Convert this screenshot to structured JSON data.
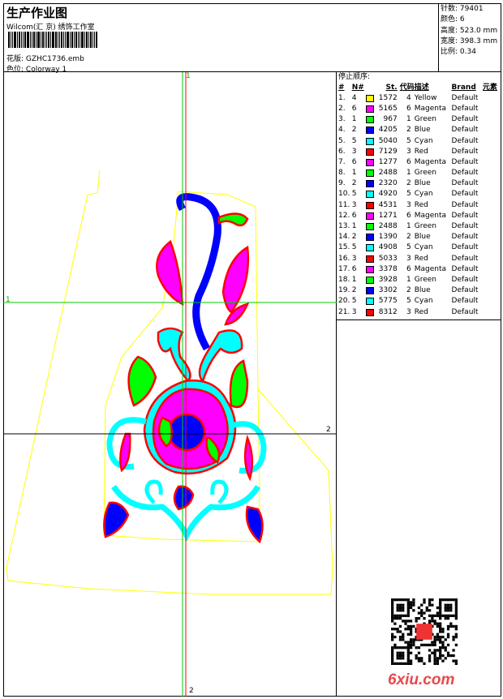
{
  "header": {
    "title": "生产作业图",
    "company": "Wilcom(汇 京) 绣饰工作室",
    "file_label": "花版:",
    "file_value": "GZHC1736.emb",
    "colorway_label": "色位:",
    "colorway_value": "Colorway 1"
  },
  "info": [
    {
      "label": "针数:",
      "value": "79401"
    },
    {
      "label": "颜色:",
      "value": "6"
    },
    {
      "label": "高度:",
      "value": "523.0 mm"
    },
    {
      "label": "宽度:",
      "value": "398.3 mm"
    },
    {
      "label": "比例:",
      "value": "0.34"
    }
  ],
  "crosshair_labels": {
    "v_top": "1",
    "h_left": "1",
    "h_right": "2",
    "v_bottom": "2"
  },
  "stops": {
    "title": "停止顺序:",
    "columns": [
      "#",
      "N#",
      "St.",
      "代码",
      "描述",
      "Brand",
      "元素"
    ],
    "colors": {
      "Yellow": "#ffff00",
      "Magenta": "#ff00ff",
      "Green": "#00ff00",
      "Blue": "#0000ff",
      "Cyan": "#00ffff",
      "Red": "#ff0000"
    },
    "rows": [
      [
        "1.",
        "4",
        "1572",
        "4",
        "Yellow",
        "Default"
      ],
      [
        "2.",
        "6",
        "5165",
        "6",
        "Magenta",
        "Default"
      ],
      [
        "3.",
        "1",
        "967",
        "1",
        "Green",
        "Default"
      ],
      [
        "4.",
        "2",
        "4205",
        "2",
        "Blue",
        "Default"
      ],
      [
        "5.",
        "5",
        "5040",
        "5",
        "Cyan",
        "Default"
      ],
      [
        "6.",
        "3",
        "7129",
        "3",
        "Red",
        "Default"
      ],
      [
        "7.",
        "6",
        "1277",
        "6",
        "Magenta",
        "Default"
      ],
      [
        "8.",
        "1",
        "2488",
        "1",
        "Green",
        "Default"
      ],
      [
        "9.",
        "2",
        "2320",
        "2",
        "Blue",
        "Default"
      ],
      [
        "10.",
        "5",
        "4920",
        "5",
        "Cyan",
        "Default"
      ],
      [
        "11.",
        "3",
        "4531",
        "3",
        "Red",
        "Default"
      ],
      [
        "12.",
        "6",
        "1271",
        "6",
        "Magenta",
        "Default"
      ],
      [
        "13.",
        "1",
        "2488",
        "1",
        "Green",
        "Default"
      ],
      [
        "14.",
        "2",
        "1390",
        "2",
        "Blue",
        "Default"
      ],
      [
        "15.",
        "5",
        "4908",
        "5",
        "Cyan",
        "Default"
      ],
      [
        "16.",
        "3",
        "5033",
        "3",
        "Red",
        "Default"
      ],
      [
        "17.",
        "6",
        "3378",
        "6",
        "Magenta",
        "Default"
      ],
      [
        "18.",
        "1",
        "3928",
        "1",
        "Green",
        "Default"
      ],
      [
        "19.",
        "2",
        "3302",
        "2",
        "Blue",
        "Default"
      ],
      [
        "20.",
        "5",
        "5775",
        "5",
        "Cyan",
        "Default"
      ],
      [
        "21.",
        "3",
        "8312",
        "3",
        "Red",
        "Default"
      ]
    ]
  },
  "watermark": "6xiu.com"
}
